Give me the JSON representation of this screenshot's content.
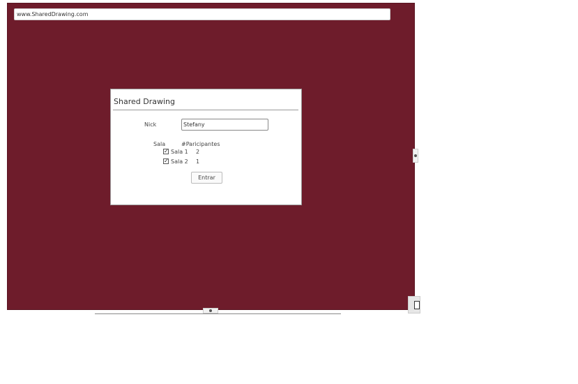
{
  "browser": {
    "url": "www.SharedDrawing.com"
  },
  "dialog": {
    "title": "Shared Drawing",
    "nick_label": "Nick",
    "nick_value": "Stefany",
    "rooms_header": "Sala",
    "participants_header": "#Paricipantes",
    "rooms": [
      {
        "name": "Sala 1",
        "participants": "2",
        "checked": true
      },
      {
        "name": "Sala 2",
        "participants": "1",
        "checked": true
      }
    ],
    "enter_label": "Entrar"
  },
  "colors": {
    "canvas_background": "#6e1c2b"
  },
  "icons": {
    "check": "check-icon",
    "tablet": "tablet-icon"
  }
}
